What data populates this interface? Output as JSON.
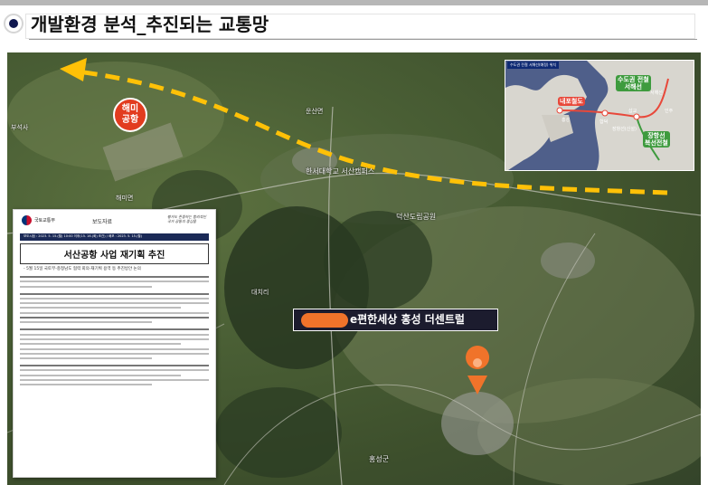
{
  "header": {
    "title": "개발환경 분석_추진되는 교통망"
  },
  "labels": {
    "airport": "해미\n공항",
    "site": "e편한세상 홍성 더센트럴"
  },
  "document": {
    "ministry": "국토교통부",
    "doctype": "보도자료",
    "slogan": "평가도 존중하는 합리적인 국가 공동의 중심을",
    "dateline": "보도시점 : 2023. 5. 15.(월) 10:00 이후(15. 16.(화) 조간) / 배포 : 2023. 5. 15.(월)",
    "title": "서산공항 사업 재기획 추진",
    "subtitle": "- 5월 15일 국토부-충청남도 협력 회의-재기획 용역 등 추진방안 논의"
  },
  "map_places": [
    {
      "label": "해미면",
      "name": "place-haemi"
    },
    {
      "label": "부석사",
      "name": "place-buseoksa"
    },
    {
      "label": "한서대학교 서산캠퍼스",
      "name": "place-hanseo-univ"
    },
    {
      "label": "덕산도립공원",
      "name": "place-deoksan-park"
    },
    {
      "label": "홍성군",
      "name": "place-hongseong"
    },
    {
      "label": "대치리",
      "name": "place-daechi"
    },
    {
      "label": "운산면",
      "name": "place-unsan"
    }
  ],
  "inset": {
    "legend": "수도권 전철 서해선(예정) 위치",
    "tags": [
      {
        "label": "내포철도",
        "color": "#e8483a"
      },
      {
        "label": "수도권 전철\n서해선",
        "color": "#3e9b3e"
      },
      {
        "label": "장항선\n복선전철",
        "color": "#3e9b3e"
      }
    ],
    "labels": [
      "홍성",
      "삽교",
      "합덕",
      "인주",
      "장항선(신설)",
      "서해선"
    ]
  },
  "colors": {
    "route": "#ffc107",
    "airport_badge": "#e23c1f",
    "site_marker": "#f0732a",
    "header_bullet": "#101850"
  }
}
